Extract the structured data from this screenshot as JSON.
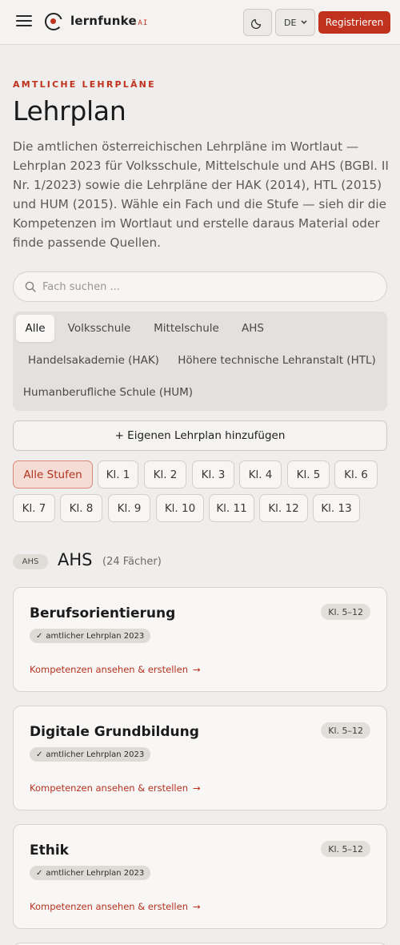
{
  "header": {
    "logo_text": "lernfunke",
    "logo_suffix": ".AI",
    "language": "DE",
    "register_label": "Registrieren",
    "icons": {
      "menu": "hamburger-menu-icon",
      "theme": "moon-icon",
      "search": "search-icon"
    }
  },
  "intro": {
    "eyebrow": "AMTLICHE LEHRPLÄNE",
    "title": "Lehrplan",
    "description": "Die amtlichen österreichischen Lehrpläne im Wortlaut — Lehrplan 2023 für Volksschule, Mittelschule und AHS (BGBl. II Nr. 1/2023) sowie die Lehrpläne der HAK (2014), HTL (2015) und HUM (2015). Wähle ein Fach und die Stufe — sieh dir die Kompetenzen im Wortlaut und erstelle daraus Material oder finde passende Quellen."
  },
  "search": {
    "placeholder": "Fach suchen ..."
  },
  "school_tabs": [
    {
      "label": "Alle",
      "active": true
    },
    {
      "label": "Volksschule"
    },
    {
      "label": "Mittelschule"
    },
    {
      "label": "AHS"
    },
    {
      "label": "Handelsakademie (HAK)"
    },
    {
      "label": "Höhere technische Lehranstalt (HTL)"
    },
    {
      "label": "Humanberufliche Schule (HUM)"
    }
  ],
  "add_button": "+ Eigenen Lehrplan hinzufügen",
  "grade_chips": [
    {
      "label": "Alle Stufen",
      "active": true
    },
    {
      "label": "Kl. 1"
    },
    {
      "label": "Kl. 2"
    },
    {
      "label": "Kl. 3"
    },
    {
      "label": "Kl. 4"
    },
    {
      "label": "Kl. 5"
    },
    {
      "label": "Kl. 6"
    },
    {
      "label": "Kl. 7"
    },
    {
      "label": "Kl. 8"
    },
    {
      "label": "Kl. 9"
    },
    {
      "label": "Kl. 10"
    },
    {
      "label": "Kl. 11"
    },
    {
      "label": "Kl. 12"
    },
    {
      "label": "Kl. 13"
    }
  ],
  "section": {
    "badge": "AHS",
    "title": "AHS",
    "count": "(24 Fächer)"
  },
  "subjects": [
    {
      "title": "Berufsorientierung",
      "grades": "Kl. 5–12",
      "badge": "amtlicher Lehrplan 2023",
      "link": "Kompetenzen ansehen & erstellen"
    },
    {
      "title": "Digitale Grundbildung",
      "grades": "Kl. 5–12",
      "badge": "amtlicher Lehrplan 2023",
      "link": "Kompetenzen ansehen & erstellen"
    },
    {
      "title": "Ethik",
      "grades": "Kl. 5–12",
      "badge": "amtlicher Lehrplan 2023",
      "link": "Kompetenzen ansehen & erstellen"
    }
  ],
  "colors": {
    "accent": "#c0321e",
    "background": "#efeeec"
  }
}
